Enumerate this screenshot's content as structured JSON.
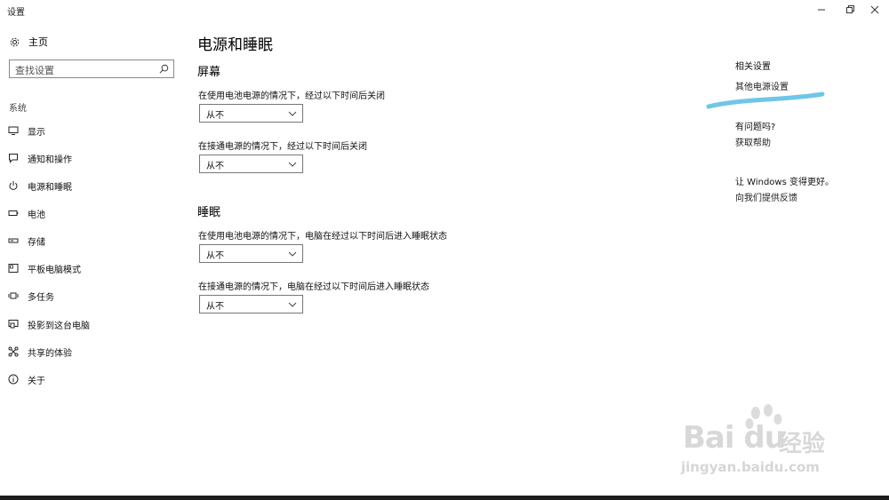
{
  "window": {
    "title": "设置",
    "controls": [
      "minimize-icon",
      "maximize-icon",
      "close-icon"
    ]
  },
  "sidebar": {
    "home_label": "主页",
    "search_placeholder": "查找设置",
    "section_label": "系统",
    "items": [
      {
        "label": "显示",
        "icon": "display-icon"
      },
      {
        "label": "通知和操作",
        "icon": "notifications-icon"
      },
      {
        "label": "电源和睡眠",
        "icon": "power-icon",
        "active": true
      },
      {
        "label": "电池",
        "icon": "battery-icon"
      },
      {
        "label": "存储",
        "icon": "storage-icon"
      },
      {
        "label": "平板电脑模式",
        "icon": "tablet-mode-icon"
      },
      {
        "label": "多任务",
        "icon": "multitasking-icon"
      },
      {
        "label": "投影到这台电脑",
        "icon": "projecting-icon"
      },
      {
        "label": "共享的体验",
        "icon": "shared-experiences-icon"
      },
      {
        "label": "关于",
        "icon": "info-icon"
      }
    ]
  },
  "main": {
    "page_title": "电源和睡眠",
    "screen": {
      "title": "屏幕",
      "battery_desc": "在使用电池电源的情况下，经过以下时间后关闭",
      "battery_value": "从不",
      "plugged_desc": "在接通电源的情况下，经过以下时间后关闭",
      "plugged_value": "从不"
    },
    "sleep": {
      "title": "睡眠",
      "battery_desc": "在使用电池电源的情况下，电脑在经过以下时间后进入睡眠状态",
      "battery_value": "从不",
      "plugged_desc": "在接通电源的情况下，电脑在经过以下时间后进入睡眠状态",
      "plugged_value": "从不"
    }
  },
  "related": {
    "heading": "相关设置",
    "other_power_link": "其他电源设置",
    "question_heading": "有问题吗?",
    "help_link": "获取帮助",
    "improve_heading": "让 Windows 变得更好。",
    "feedback_link": "向我们提供反馈"
  },
  "colors": {
    "highlight_stroke": "#6ec6e8",
    "watermark": "#d8d8d8"
  },
  "watermark": {
    "logo": "Bai du",
    "cn": "经验",
    "url": "jingyan.baidu.com"
  }
}
